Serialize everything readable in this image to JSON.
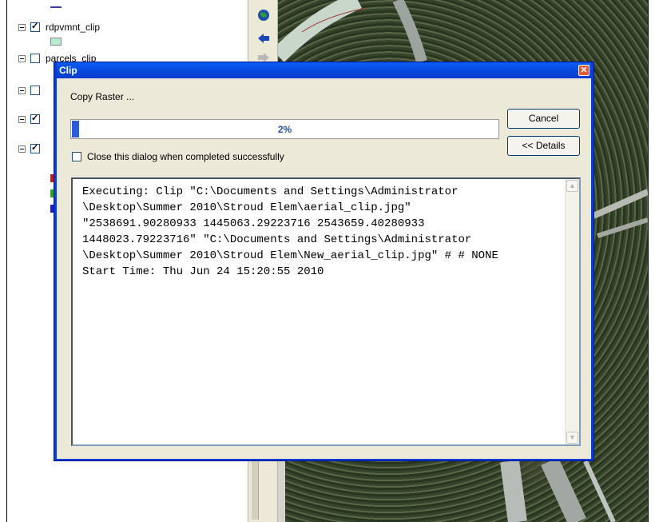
{
  "toc": {
    "layers": [
      {
        "label": "rdpvmnt_clip",
        "checked": true
      },
      {
        "label": "parcels_clip",
        "checked": false
      },
      {
        "label": "",
        "checked": false
      },
      {
        "label": "",
        "checked": true
      },
      {
        "label": "",
        "checked": true
      }
    ]
  },
  "toolbar": {
    "icons": [
      "globe-icon",
      "back-arrow-icon",
      "forward-arrow-icon"
    ]
  },
  "dialog": {
    "title": "Clip",
    "status_text": "Copy Raster ...",
    "cancel_label": "Cancel",
    "details_label": "<< Details",
    "progress_percent": 2,
    "progress_label": "2%",
    "close_when_done_label": "Close this dialog when completed successfully",
    "close_when_done_checked": false,
    "log_text": "Executing: Clip \"C:\\Documents and Settings\\Administrator\n\\Desktop\\Summer 2010\\Stroud Elem\\aerial_clip.jpg\"\n\"2538691.90280933 1445063.29223716 2543659.40280933\n1448023.79223716\" \"C:\\Documents and Settings\\Administrator\n\\Desktop\\Summer 2010\\Stroud Elem\\New_aerial_clip.jpg\" # # NONE\nStart Time: Thu Jun 24 15:20:55 2010"
  },
  "colors": {
    "dialog_frame": "#0a3cd8",
    "progress_fill": "#2d5cd6",
    "client_bg": "#ece9d8"
  }
}
